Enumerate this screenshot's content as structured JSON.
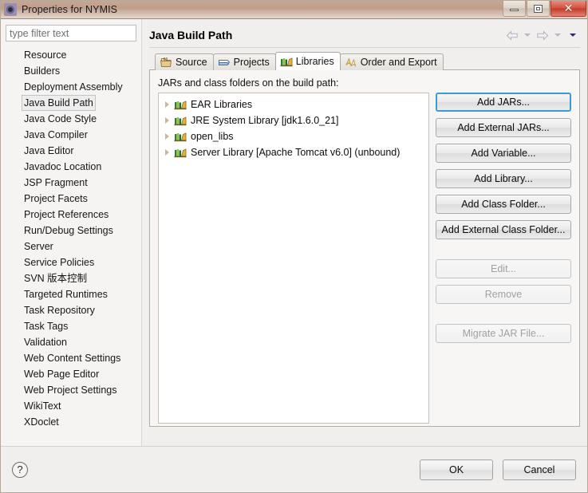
{
  "window": {
    "title": "Properties for NYMIS",
    "icon": "properties-icon",
    "controls": {
      "minimize": "Minimize",
      "maximize": "Maximize",
      "close": "Close"
    }
  },
  "sidebar": {
    "filter": {
      "placeholder": "type filter text",
      "value": ""
    },
    "selected": "Java Build Path",
    "items": [
      {
        "label": "Resource"
      },
      {
        "label": "Builders"
      },
      {
        "label": "Deployment Assembly"
      },
      {
        "label": "Java Build Path"
      },
      {
        "label": "Java Code Style"
      },
      {
        "label": "Java Compiler"
      },
      {
        "label": "Java Editor"
      },
      {
        "label": "Javadoc Location"
      },
      {
        "label": "JSP Fragment"
      },
      {
        "label": "Project Facets"
      },
      {
        "label": "Project References"
      },
      {
        "label": "Run/Debug Settings"
      },
      {
        "label": "Server"
      },
      {
        "label": "Service Policies"
      },
      {
        "label": "SVN 版本控制"
      },
      {
        "label": "Targeted Runtimes"
      },
      {
        "label": "Task Repository"
      },
      {
        "label": "Task Tags"
      },
      {
        "label": "Validation"
      },
      {
        "label": "Web Content Settings"
      },
      {
        "label": "Web Page Editor"
      },
      {
        "label": "Web Project Settings"
      },
      {
        "label": "WikiText"
      },
      {
        "label": "XDoclet"
      }
    ]
  },
  "page": {
    "title": "Java Build Path",
    "nav": {
      "back": "back-arrow-icon",
      "back_menu": "back-history-dropdown-icon",
      "forward": "forward-arrow-icon",
      "forward_menu": "forward-history-dropdown-icon",
      "view_menu": "view-menu-dropdown-icon"
    }
  },
  "tabs": [
    {
      "label": "Source",
      "icon": "source-folder-icon",
      "active": false
    },
    {
      "label": "Projects",
      "icon": "projects-folder-icon",
      "active": false
    },
    {
      "label": "Libraries",
      "icon": "libraries-icon",
      "active": true
    },
    {
      "label": "Order and Export",
      "icon": "order-export-icon",
      "active": false
    }
  ],
  "libraries_tab": {
    "list_label": "JARs and class folders on the build path:",
    "entries": [
      {
        "label": "EAR Libraries",
        "expandable": true,
        "icon": "library-icon"
      },
      {
        "label": "JRE System Library [jdk1.6.0_21]",
        "expandable": true,
        "icon": "library-icon"
      },
      {
        "label": "open_libs",
        "expandable": true,
        "icon": "library-icon"
      },
      {
        "label": "Server Library [Apache Tomcat v6.0] (unbound)",
        "expandable": true,
        "icon": "library-icon"
      }
    ],
    "buttons": [
      {
        "label": "Add JARs...",
        "enabled": true,
        "focused": true
      },
      {
        "label": "Add External JARs...",
        "enabled": true,
        "focused": false
      },
      {
        "label": "Add Variable...",
        "enabled": true,
        "focused": false
      },
      {
        "label": "Add Library...",
        "enabled": true,
        "focused": false
      },
      {
        "label": "Add Class Folder...",
        "enabled": true,
        "focused": false
      },
      {
        "label": "Add External Class Folder...",
        "enabled": true,
        "focused": false
      },
      {
        "label": "Edit...",
        "enabled": false,
        "focused": false
      },
      {
        "label": "Remove",
        "enabled": false,
        "focused": false
      },
      {
        "label": "Migrate JAR File...",
        "enabled": false,
        "focused": false
      }
    ]
  },
  "footer": {
    "help": "?",
    "ok_label": "OK",
    "cancel_label": "Cancel"
  },
  "colors": {
    "titlebar": "#c6a793",
    "close_button": "#c23b27",
    "focus_border": "#3c9bd4",
    "selection": "#ededed",
    "disabled_text": "#a0a0a0"
  }
}
